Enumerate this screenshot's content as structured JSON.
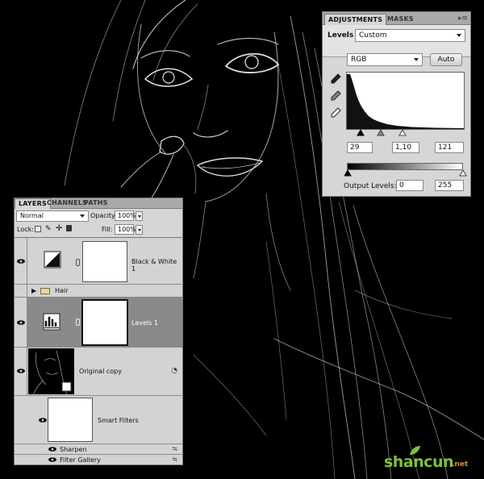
{
  "adjustments_panel": {
    "tabs": [
      "ADJUSTMENTS",
      "MASKS"
    ],
    "title": "Levels",
    "preset": "Custom",
    "channel": "RGB",
    "auto_button": "Auto",
    "input_levels": {
      "black": "29",
      "gamma": "1,10",
      "white": "121"
    },
    "output_label": "Output Levels:",
    "output_levels": {
      "black": "0",
      "white": "255"
    }
  },
  "layers_panel": {
    "tabs": [
      "LAYERS",
      "CHANNELS",
      "PATHS"
    ],
    "blend_mode": "Normal",
    "opacity_label": "Opacity:",
    "opacity": "100%",
    "lock_label": "Lock:",
    "fill_label": "Fill:",
    "fill": "100%",
    "layers": [
      {
        "name": "Black & White 1",
        "visible": true,
        "selected": false
      },
      {
        "name": "Hair",
        "visible": false,
        "selected": false
      },
      {
        "name": "Levels 1",
        "visible": true,
        "selected": true
      },
      {
        "name": "Original copy",
        "visible": true,
        "selected": false
      },
      {
        "name": "Smart Filters",
        "visible": true,
        "selected": false
      },
      {
        "name": "Sharpen",
        "visible": true,
        "selected": false
      },
      {
        "name": "Filter Gallery",
        "visible": true,
        "selected": false
      }
    ]
  },
  "watermark": {
    "text": "shancun",
    "suffix": ".net"
  },
  "colors": {
    "panel_bg": "#d6d6d6",
    "selected_row": "#8a8a8a",
    "canvas_bg": "#000000"
  }
}
